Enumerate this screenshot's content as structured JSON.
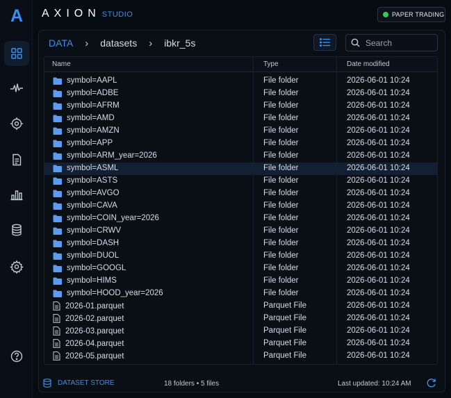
{
  "app": {
    "logo_letter": "A",
    "brand_name": "AXION",
    "brand_sub": "STUDIO",
    "mode_badge": "PAPER TRADING",
    "accent": "#3b8ff0",
    "status_color": "#3ec45a"
  },
  "sidebar": {
    "items": [
      {
        "icon": "grid-icon",
        "active": true
      },
      {
        "icon": "activity-icon",
        "active": false
      },
      {
        "icon": "target-icon",
        "active": false
      },
      {
        "icon": "document-icon",
        "active": false
      },
      {
        "icon": "bar-chart-icon",
        "active": false
      },
      {
        "icon": "database-icon",
        "active": false
      },
      {
        "icon": "gear-icon",
        "active": false
      }
    ],
    "help_icon": "help-icon"
  },
  "breadcrumb": {
    "root": "DATA",
    "items": [
      "datasets",
      "ibkr_5s"
    ]
  },
  "toolbar": {
    "view_icon": "list-view-icon",
    "search_placeholder": "Search"
  },
  "table": {
    "columns": [
      "Name",
      "Type",
      "Date modified"
    ],
    "rows": [
      {
        "name": "symbol=AAPL",
        "type": "File folder",
        "date": "2026-06-01 10:24",
        "kind": "folder"
      },
      {
        "name": "symbol=ADBE",
        "type": "File folder",
        "date": "2026-06-01 10:24",
        "kind": "folder"
      },
      {
        "name": "symbol=AFRM",
        "type": "File folder",
        "date": "2026-06-01 10:24",
        "kind": "folder"
      },
      {
        "name": "symbol=AMD",
        "type": "File folder",
        "date": "2026-06-01 10:24",
        "kind": "folder"
      },
      {
        "name": "symbol=AMZN",
        "type": "File folder",
        "date": "2026-06-01 10:24",
        "kind": "folder"
      },
      {
        "name": "symbol=APP",
        "type": "File folder",
        "date": "2026-06-01 10:24",
        "kind": "folder"
      },
      {
        "name": "symbol=ARM_year=2026",
        "type": "File folder",
        "date": "2026-06-01 10:24",
        "kind": "folder"
      },
      {
        "name": "symbol=ASML",
        "type": "File folder",
        "date": "2026-06-01 10:24",
        "kind": "folder",
        "selected": true
      },
      {
        "name": "symbol=ASTS",
        "type": "File folder",
        "date": "2026-06-01 10:24",
        "kind": "folder"
      },
      {
        "name": "symbol=AVGO",
        "type": "File folder",
        "date": "2026-06-01 10:24",
        "kind": "folder"
      },
      {
        "name": "symbol=CAVA",
        "type": "File folder",
        "date": "2026-06-01 10:24",
        "kind": "folder"
      },
      {
        "name": "symbol=COIN_year=2026",
        "type": "File folder",
        "date": "2026-06-01 10:24",
        "kind": "folder"
      },
      {
        "name": "symbol=CRWV",
        "type": "File folder",
        "date": "2026-06-01 10:24",
        "kind": "folder"
      },
      {
        "name": "symbol=DASH",
        "type": "File folder",
        "date": "2026-06-01 10:24",
        "kind": "folder"
      },
      {
        "name": "symbol=DUOL",
        "type": "File folder",
        "date": "2026-06-01 10:24",
        "kind": "folder"
      },
      {
        "name": "symbol=GOOGL",
        "type": "File folder",
        "date": "2026-06-01 10:24",
        "kind": "folder"
      },
      {
        "name": "symbol=HIMS",
        "type": "File folder",
        "date": "2026-06-01 10:24",
        "kind": "folder"
      },
      {
        "name": "symbol=HOOD_year=2026",
        "type": "File folder",
        "date": "2026-06-01 10:24",
        "kind": "folder"
      },
      {
        "name": "2026-01.parquet",
        "type": "Parquet File",
        "date": "2026-06-01 10:24",
        "kind": "file"
      },
      {
        "name": "2026-02.parquet",
        "type": "Parquet File",
        "date": "2026-06-01 10:24",
        "kind": "file"
      },
      {
        "name": "2026-03.parquet",
        "type": "Parquet File",
        "date": "2026-06-01 10:24",
        "kind": "file"
      },
      {
        "name": "2026-04.parquet",
        "type": "Parquet File",
        "date": "2026-06-01 10:24",
        "kind": "file"
      },
      {
        "name": "2026-05.parquet",
        "type": "Parquet File",
        "date": "2026-06-01 10:24",
        "kind": "file"
      }
    ]
  },
  "footer": {
    "store_label": "DATASET STORE",
    "counts": "18 folders  •  5 files",
    "updated": "Last updated: 10:24 AM"
  }
}
